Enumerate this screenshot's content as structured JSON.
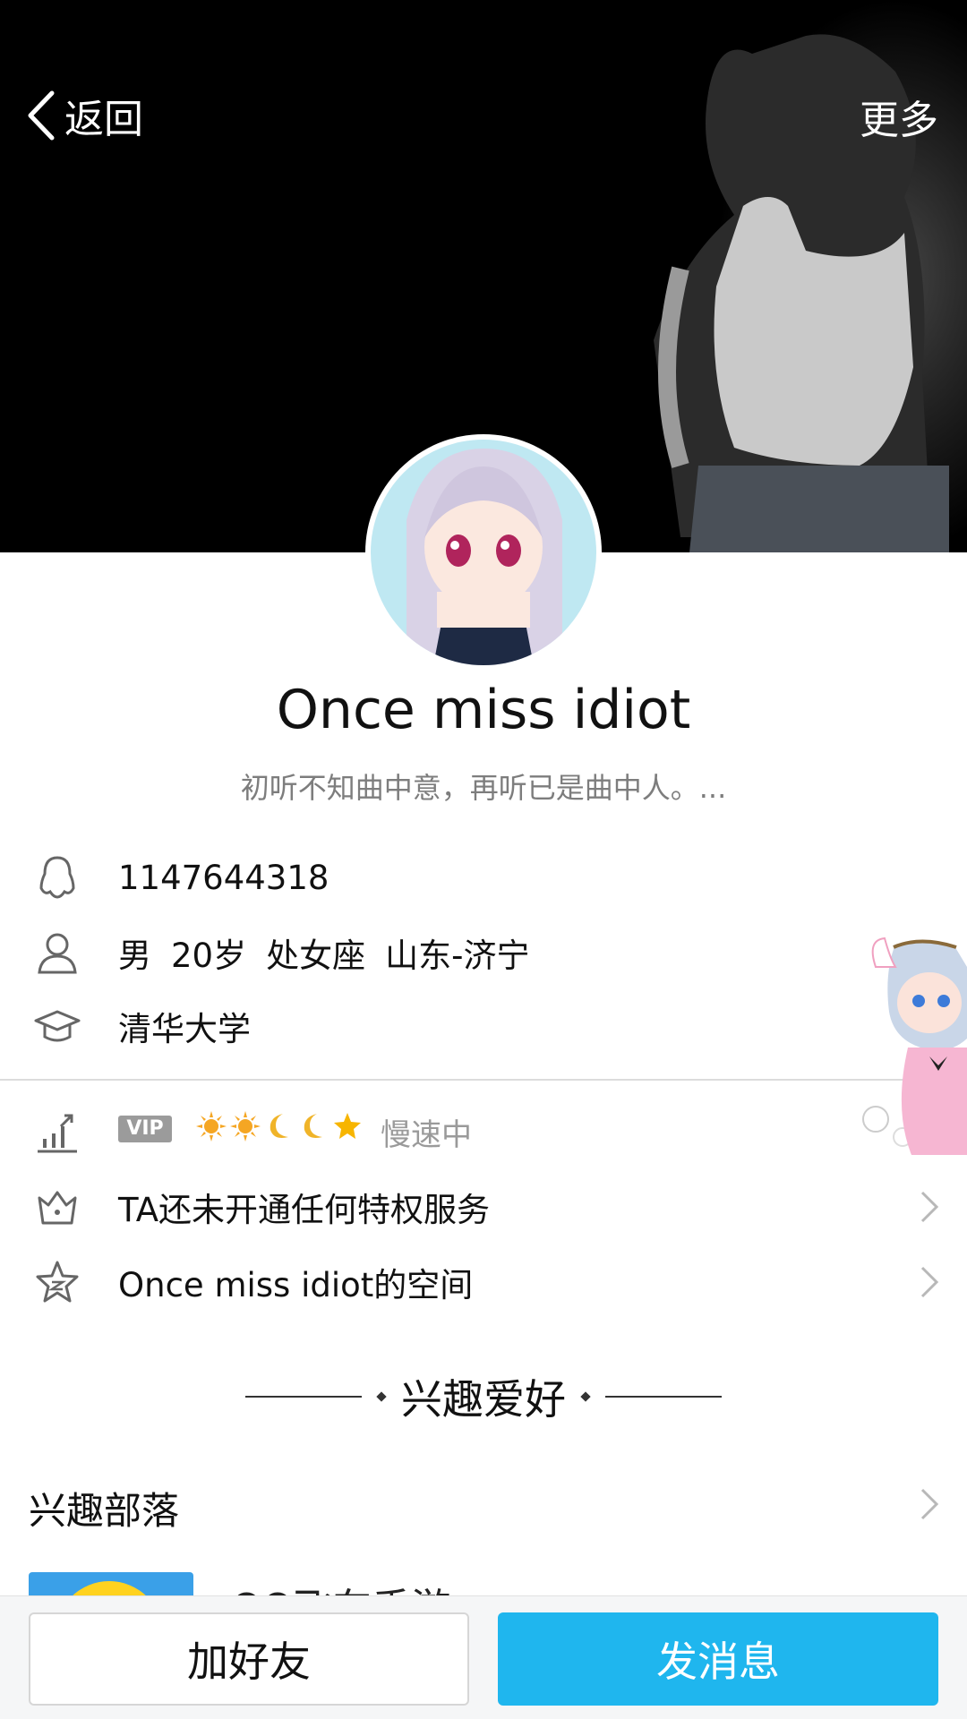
{
  "nav": {
    "back_label": "返回",
    "more_label": "更多"
  },
  "profile": {
    "nickname": "Once miss idiot",
    "signature": "初听不知曲中意，再听已是曲中人。..."
  },
  "info": {
    "qq_number": "1147644318",
    "gender": "男",
    "age": "20岁",
    "zodiac": "处女座",
    "location": "山东-济宁",
    "school": "清华大学"
  },
  "level": {
    "vip_badge": "VIP",
    "status": "慢速中",
    "icons": [
      "sun-icon",
      "sun-icon",
      "moon-icon",
      "moon-icon",
      "star-icon"
    ]
  },
  "privilege": {
    "label": "TA还未开通任何特权服务"
  },
  "space": {
    "label": "Once miss idiot的空间"
  },
  "interests": {
    "section_title": "兴趣爱好",
    "tribe_label": "兴趣部落",
    "tribe_item": "QQ飞车手游"
  },
  "actions": {
    "add_friend": "加好友",
    "send_message": "发消息"
  },
  "colors": {
    "accent": "#1fb6ee",
    "muted_text": "#7d7d7d"
  }
}
